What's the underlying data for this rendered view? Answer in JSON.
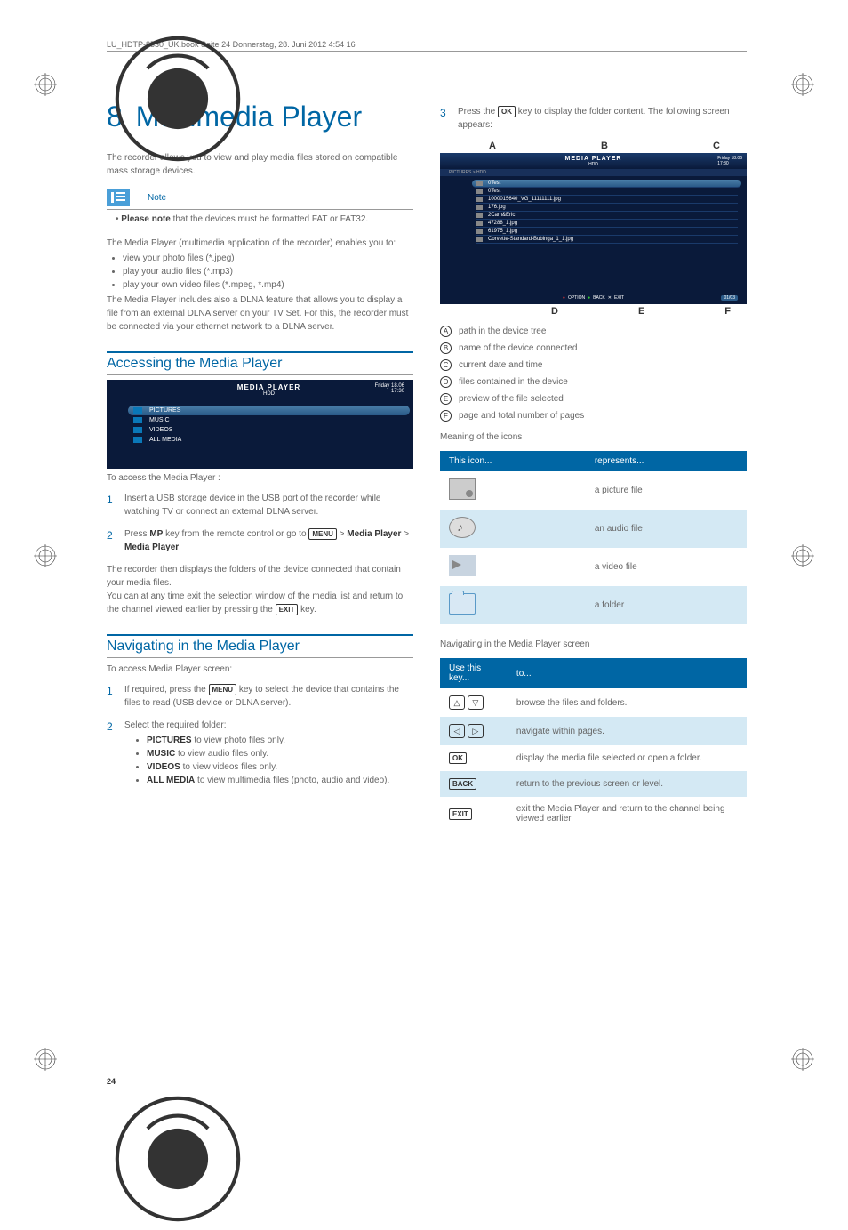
{
  "meta": {
    "header_line": "LU_HDTP-8530_UK.book  Seite 24  Donnerstag, 28. Juni 2012  4:54 16",
    "page_number": "24"
  },
  "chapter": {
    "number": "8",
    "title": "Multimedia Player"
  },
  "left": {
    "intro": "The recorder allows you to view and play media files stored on compatible mass storage devices.",
    "note_label": "Note",
    "note_prefix": "Please note",
    "note_body": " that the devices must be formatted FAT or FAT32.",
    "enables": "The Media Player (multimedia application of the recorder) enables you to:",
    "bullets": [
      "view your photo files (*.jpeg)",
      "play your audio files (*.mp3)",
      "play your own video files (*.mpeg, *.mp4)"
    ],
    "dlna": "The Media Player includes also a DLNA feature that allows you to display a file from an external DLNA server on your TV Set. For this, the recorder must be connected via your ethernet network to a DLNA server.",
    "section1": "Accessing the Media Player",
    "screenshot1": {
      "title": "MEDIA PLAYER",
      "sub": "HDD",
      "date_line1": "Friday 18.06",
      "date_line2": "17:30",
      "rows": [
        "PICTURES",
        "MUSIC",
        "VIDEOS",
        "ALL MEDIA"
      ]
    },
    "access_caption": "To access the Media Player :",
    "step1": "Insert a USB storage device in the USB port of the recorder while watching TV or connect an external DLNA server.",
    "step2_a": "Press ",
    "step2_mp": "MP",
    "step2_b": " key from the remote control or go to ",
    "step2_menu": "MENU",
    "step2_c": " > ",
    "step2_bold1": "Media Player",
    "step2_d": " > ",
    "step2_bold2": "Media Player",
    "step2_e": ".",
    "after_steps1": "The recorder then displays the folders of the device connected that contain your media files.",
    "after_steps2a": "You can at any time exit the selection window of the media list and return to the channel viewed earlier by pressing the ",
    "after_steps2_key": "EXIT",
    "after_steps2b": " key.",
    "section2": "Navigating in the Media Player",
    "nav_caption": "To access Media Player screen:",
    "nav_step1a": "If required, press the ",
    "nav_step1_key": "MENU",
    "nav_step1b": " key to select the device that contains the files to read (USB device or DLNA server).",
    "nav_step2": "Select the required folder:",
    "nav_sub": [
      {
        "b": "PICTURES",
        "t": " to view photo files only."
      },
      {
        "b": "MUSIC",
        "t": " to view audio files only."
      },
      {
        "b": "VIDEOS",
        "t": " to view videos files only."
      },
      {
        "b": "ALL MEDIA",
        "t": " to view multimedia files (photo, audio and video)."
      }
    ]
  },
  "right": {
    "step3a": "Press the ",
    "step3_key": "OK",
    "step3b": " key to display the folder content. The following screen appears:",
    "labels_top": [
      "A",
      "B",
      "C"
    ],
    "labels_bot": [
      "D",
      "E",
      "F"
    ],
    "screenshot2": {
      "title": "MEDIA PLAYER",
      "sub": "HDD",
      "date_line1": "Friday 18.06",
      "date_line2": "17:30",
      "crumb": "PICTURES > HDD",
      "rows": [
        "0Test",
        "0Test",
        "1000015640_VG_11111111.jpg",
        "176.jpg",
        "2Cam&Eric",
        "47288_1.jpg",
        "61975_1.jpg",
        "Corvette-Standard-Bubinga_1_1.jpg"
      ],
      "footer_option": "OPTION",
      "footer_back": "BACK",
      "footer_exit": "EXIT",
      "page_indicator": "01/03"
    },
    "callouts": [
      {
        "l": "A",
        "t": "path in the device tree"
      },
      {
        "l": "B",
        "t": "name of the device connected"
      },
      {
        "l": "C",
        "t": "current date and time"
      },
      {
        "l": "D",
        "t": "files contained in the device"
      },
      {
        "l": "E",
        "t": "preview of the file selected"
      },
      {
        "l": "F",
        "t": "page and total number of pages"
      }
    ],
    "meaning": "Meaning of the icons",
    "icon_table": {
      "h1": "This icon...",
      "h2": "represents...",
      "rows": [
        "a picture file",
        "an audio file",
        "a video file",
        "a folder"
      ]
    },
    "nav_screen": "Navigating in the Media Player screen",
    "key_table": {
      "h1": "Use this key...",
      "h2": "to...",
      "rows": [
        "browse the files and folders.",
        "navigate within pages.",
        "display the media file selected or open a folder.",
        "return to the previous screen or level.",
        "exit the Media Player and return to the channel being viewed earlier."
      ],
      "keys": {
        "ok": "OK",
        "back": "BACK",
        "exit": "EXIT"
      }
    }
  }
}
